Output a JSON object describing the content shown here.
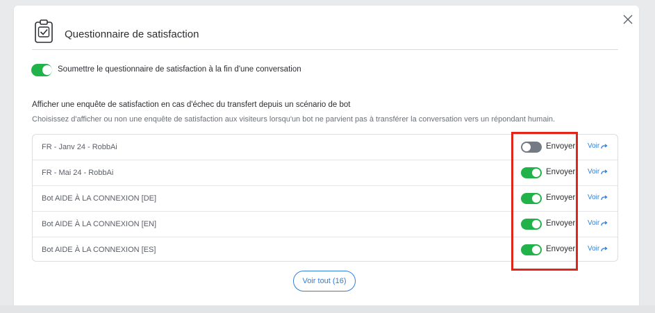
{
  "dialog": {
    "title": "Questionnaire de satisfaction",
    "close_icon": "close-icon",
    "header_icon": "clipboard-check-icon"
  },
  "main_toggle": {
    "state": "on",
    "label": "Soumettre le questionnaire de satisfaction à la fin d'une conversation"
  },
  "section": {
    "title": "Afficher une enquête de satisfaction en cas d'échec du transfert depuis un scénario de bot",
    "description": "Choisissez d'afficher ou non une enquête de satisfaction aux visiteurs lorsqu'un bot ne parvient pas à transférer la conversation vers un répondant humain."
  },
  "bots": [
    {
      "name": "FR - Janv 24 - RobbAi",
      "enabled": false,
      "send_label": "Envoyer",
      "view_label": "Voir"
    },
    {
      "name": "FR - Mai 24 - RobbAi",
      "enabled": true,
      "send_label": "Envoyer",
      "view_label": "Voir"
    },
    {
      "name": "Bot AIDE À LA CONNEXION [DE]",
      "enabled": true,
      "send_label": "Envoyer",
      "view_label": "Voir"
    },
    {
      "name": "Bot AIDE À LA CONNEXION [EN]",
      "enabled": true,
      "send_label": "Envoyer",
      "view_label": "Voir"
    },
    {
      "name": "Bot AIDE À LA CONNEXION [ES]",
      "enabled": true,
      "send_label": "Envoyer",
      "view_label": "Voir"
    }
  ],
  "see_all_label": "Voir tout (16)",
  "colors": {
    "toggle_on": "#21b34a",
    "toggle_off": "#757b84",
    "link": "#2e7fd9",
    "highlight": "#e0251b"
  }
}
